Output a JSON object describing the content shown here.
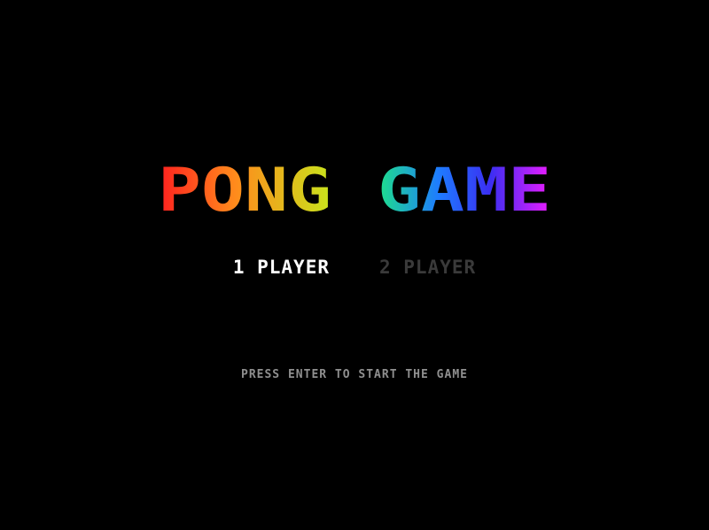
{
  "title": {
    "word1": "PONG",
    "word2": "GAME",
    "gradient_colors": [
      "#ff2020",
      "#ff8a1a",
      "#e8e01c",
      "#20d67a",
      "#1e78ff",
      "#3a2cf0",
      "#e81cff"
    ]
  },
  "menu": {
    "options": [
      {
        "label": "1 PLAYER",
        "selected": true
      },
      {
        "label": "2 PLAYER",
        "selected": false
      }
    ],
    "selected_color": "#ffffff",
    "unselected_color": "#3a3a3a"
  },
  "prompt": "PRESS ENTER TO START THE GAME",
  "background_color": "#000000"
}
